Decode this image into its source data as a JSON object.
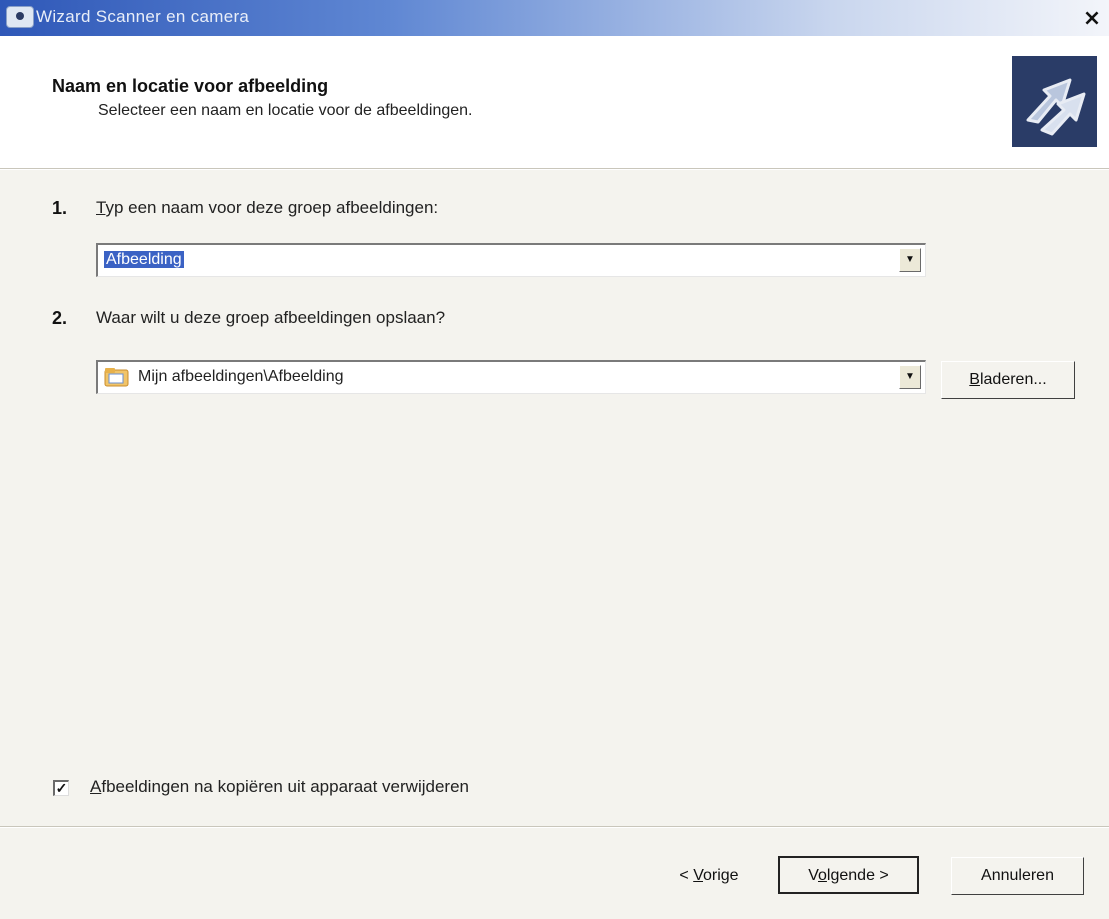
{
  "window": {
    "title": "Wizard Scanner en camera",
    "close_glyph": "×"
  },
  "header": {
    "title": "Naam en locatie voor afbeelding",
    "subtitle": "Selecteer een naam en locatie voor de afbeeldingen.",
    "image_icon": "wizard-arrows-icon"
  },
  "step1": {
    "number": "1.",
    "label_mnemonic": "T",
    "label_rest": "yp een naam voor deze groep afbeeldingen:",
    "value": "Afbeelding"
  },
  "step2": {
    "number": "2.",
    "label": "Waar wilt u deze groep afbeeldingen opslaan?",
    "value": "Mijn afbeeldingen\\Afbeelding",
    "browse_mnemonic": "B",
    "browse_rest": "laderen..."
  },
  "option": {
    "checked": true,
    "label_mnemonic": "A",
    "label_rest": "fbeeldingen na kopiëren uit apparaat verwijderen"
  },
  "footer": {
    "back_prefix": "< ",
    "back_mnemonic": "V",
    "back_rest": "orige",
    "next_prefix": "V",
    "next_mnemonic": "o",
    "next_rest": "lgende >",
    "cancel_label": "Annuleren"
  },
  "colors": {
    "titlebar_start": "#2f58b8",
    "selection": "#3b62c4",
    "header_image_bg": "#2a3c67"
  }
}
